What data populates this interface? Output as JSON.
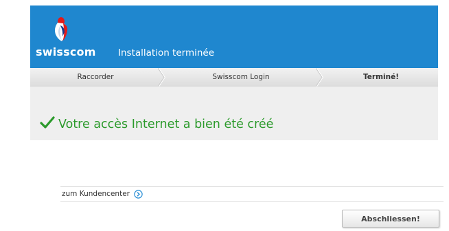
{
  "header": {
    "brand": "swisscom",
    "title": "Installation terminée",
    "logo_icon": "swisscom-logo-icon"
  },
  "steps": [
    {
      "label": "Raccorder"
    },
    {
      "label": "Swisscom Login"
    },
    {
      "label": "Terminé!"
    }
  ],
  "confirmation": {
    "icon": "checkmark-icon",
    "text": "Votre accès Internet a bien été créé",
    "color": "#2b9a2b"
  },
  "links": {
    "customer_center_label": "zum Kundencenter",
    "customer_center_icon": "circle-chevron-right-icon"
  },
  "actions": {
    "finish_label": "Abschliessen!"
  },
  "colors": {
    "brand_blue": "#1f87cf"
  }
}
